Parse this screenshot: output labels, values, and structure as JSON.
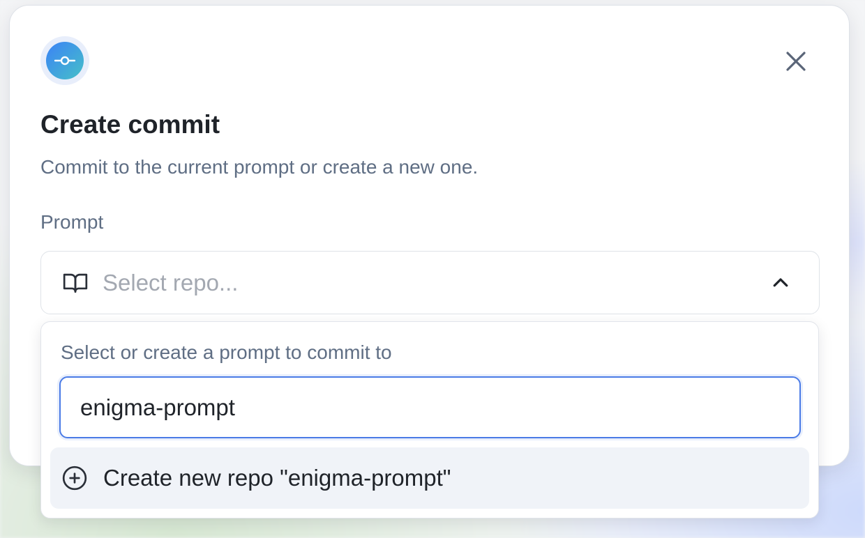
{
  "dialog": {
    "title": "Create commit",
    "subtitle": "Commit to the current prompt or create a new one.",
    "close_icon": "close-icon",
    "badge_icon": "git-commit-icon"
  },
  "prompt_field": {
    "label": "Prompt",
    "placeholder": "Select repo...",
    "icon": "book-icon",
    "expanded": true
  },
  "dropdown": {
    "label": "Select or create a prompt to commit to",
    "search_value": "enigma-prompt",
    "create_option_label": "Create new repo \"enigma-prompt\"",
    "create_option_icon": "plus-circle-icon"
  },
  "colors": {
    "accent": "#4a7be6",
    "badge_gradient_start": "#3b82f6",
    "badge_gradient_end": "#46c0c8",
    "text_primary": "#1f2329",
    "text_muted": "#5f6e84",
    "option_highlight": "#f0f3f8"
  }
}
